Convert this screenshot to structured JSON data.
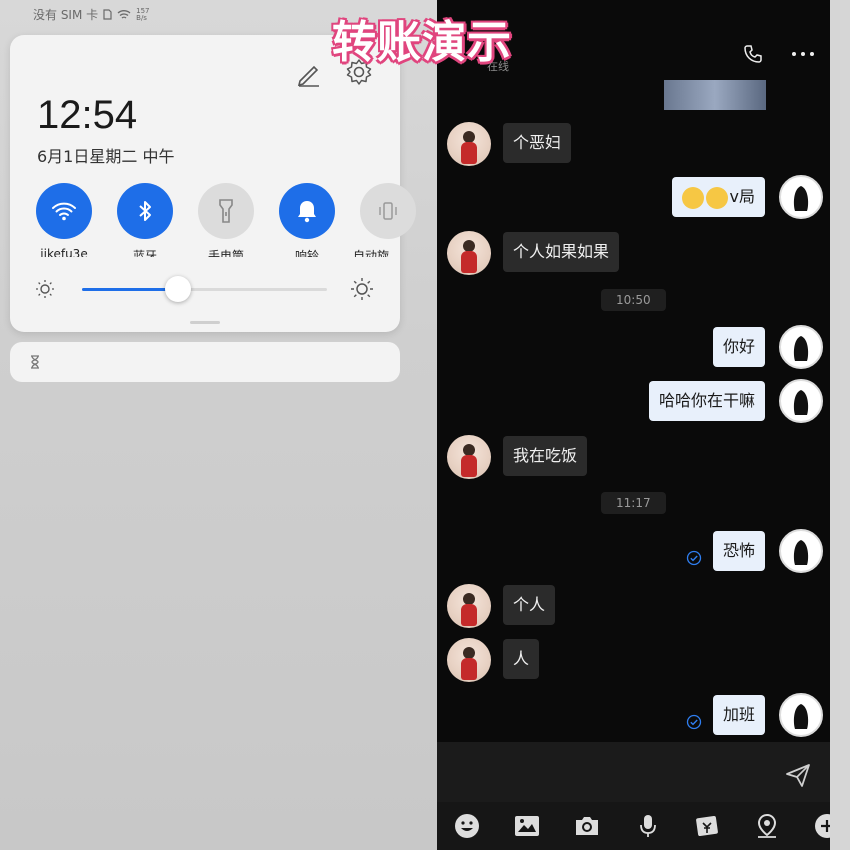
{
  "status_bar": {
    "carrier": "没有 SIM 卡",
    "net_rate": "157",
    "net_unit": "B/s"
  },
  "quick_settings": {
    "time": "12:54",
    "date": "6月1日星期二 中午",
    "tiles": [
      {
        "label": "jikefu3e",
        "icon": "wifi-icon",
        "active": true
      },
      {
        "label": "蓝牙",
        "icon": "bluetooth-icon",
        "active": true
      },
      {
        "label": "手电筒",
        "icon": "flashlight-icon",
        "active": false
      },
      {
        "label": "响铃",
        "icon": "bell-icon",
        "active": true
      },
      {
        "label": "自动旋转",
        "icon": "rotate-icon",
        "active": false
      }
    ],
    "brightness_level": 0.39
  },
  "caption": "转账演示",
  "chat": {
    "header": {
      "status": "在线"
    },
    "messages": [
      {
        "dir": "in",
        "text": "个恶妇"
      },
      {
        "dir": "out",
        "text": "v局",
        "emojis": 2
      },
      {
        "dir": "in",
        "text": "个人如果如果"
      },
      {
        "type": "time",
        "text": "10:50"
      },
      {
        "dir": "out",
        "text": "你好"
      },
      {
        "dir": "out",
        "text": "哈哈你在干嘛"
      },
      {
        "dir": "in",
        "text": "我在吃饭"
      },
      {
        "type": "time",
        "text": "11:17"
      },
      {
        "dir": "out",
        "text": "恐怖",
        "read": true
      },
      {
        "dir": "in",
        "text": "个人"
      },
      {
        "dir": "in",
        "text": "人"
      },
      {
        "dir": "out",
        "text": "加班",
        "read": true
      }
    ],
    "input": {
      "value": ""
    },
    "toolbar": [
      "emoji-icon",
      "image-icon",
      "camera-icon",
      "mic-icon",
      "red-packet-icon",
      "location-icon",
      "plus-icon"
    ]
  },
  "colors": {
    "accent": "#1e6ee8",
    "caption_outline": "#e0457e",
    "bubble_out": "#e8f0fb",
    "bubble_in": "#2b2b2b"
  }
}
